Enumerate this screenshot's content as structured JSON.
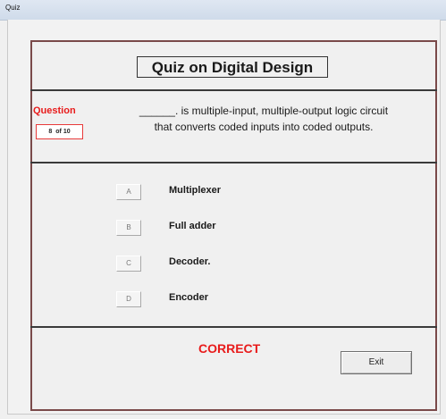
{
  "window": {
    "title": "Quiz"
  },
  "quiz": {
    "title": "Quiz on Digital Design"
  },
  "question": {
    "label": "Question",
    "number": "8",
    "of_text": "of 10",
    "text_line1": "______. is multiple-input, multiple-output logic circuit",
    "text_line2": "that converts coded inputs into coded outputs."
  },
  "options": [
    {
      "key": "A",
      "label": "Multiplexer"
    },
    {
      "key": "B",
      "label": "Full adder"
    },
    {
      "key": "C",
      "label": "Decoder."
    },
    {
      "key": "D",
      "label": "Encoder"
    }
  ],
  "status": {
    "text": "CORRECT",
    "color": "#e81b1b"
  },
  "controls": {
    "exit_label": "Exit"
  }
}
